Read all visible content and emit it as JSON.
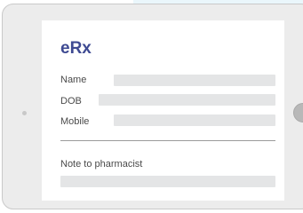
{
  "form": {
    "title": "eRx",
    "fields": [
      {
        "label": "Name",
        "value": ""
      },
      {
        "label": "DOB",
        "value": ""
      },
      {
        "label": "Mobile",
        "value": ""
      }
    ],
    "note": {
      "label": "Note to pharmacist",
      "value": ""
    }
  }
}
